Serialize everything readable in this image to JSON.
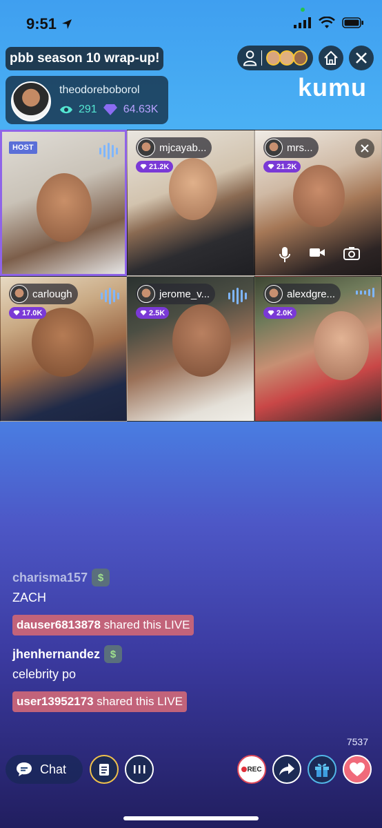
{
  "status": {
    "time": "9:51"
  },
  "room": {
    "title": "pbb season 10 wrap-up!",
    "logo": "kumu"
  },
  "host": {
    "username": "theodoreboborol",
    "viewers": "291",
    "diamonds": "64.63K"
  },
  "tiles": [
    {
      "role": "host",
      "tag": "HOST"
    },
    {
      "username": "mjcayab...",
      "diamonds": "21.2K"
    },
    {
      "username": "mrs...",
      "diamonds": "21.2K"
    },
    {
      "username": "carlough",
      "diamonds": "17.0K"
    },
    {
      "username": "jerome_v...",
      "diamonds": "2.5K"
    },
    {
      "username": "alexdgre...",
      "diamonds": "2.0K"
    }
  ],
  "chat": [
    {
      "type": "message",
      "user": "charisma157",
      "badge": "$",
      "text": "ZACH"
    },
    {
      "type": "shared",
      "user": "dauser6813878",
      "text": "shared this LIVE"
    },
    {
      "type": "message",
      "user": "jhenhernandez",
      "badge": "$",
      "text": "celebrity po"
    },
    {
      "type": "shared",
      "user": "user13952173",
      "text": "shared this LIVE"
    }
  ],
  "footer": {
    "counter": "7537",
    "chat_label": "Chat",
    "rec_label": "REC"
  },
  "colors": {
    "accent_purple": "#7a39d6",
    "host_border": "#8f64e8",
    "shared_bg": "#c2637a",
    "viewer_teal": "#54e6d2"
  }
}
